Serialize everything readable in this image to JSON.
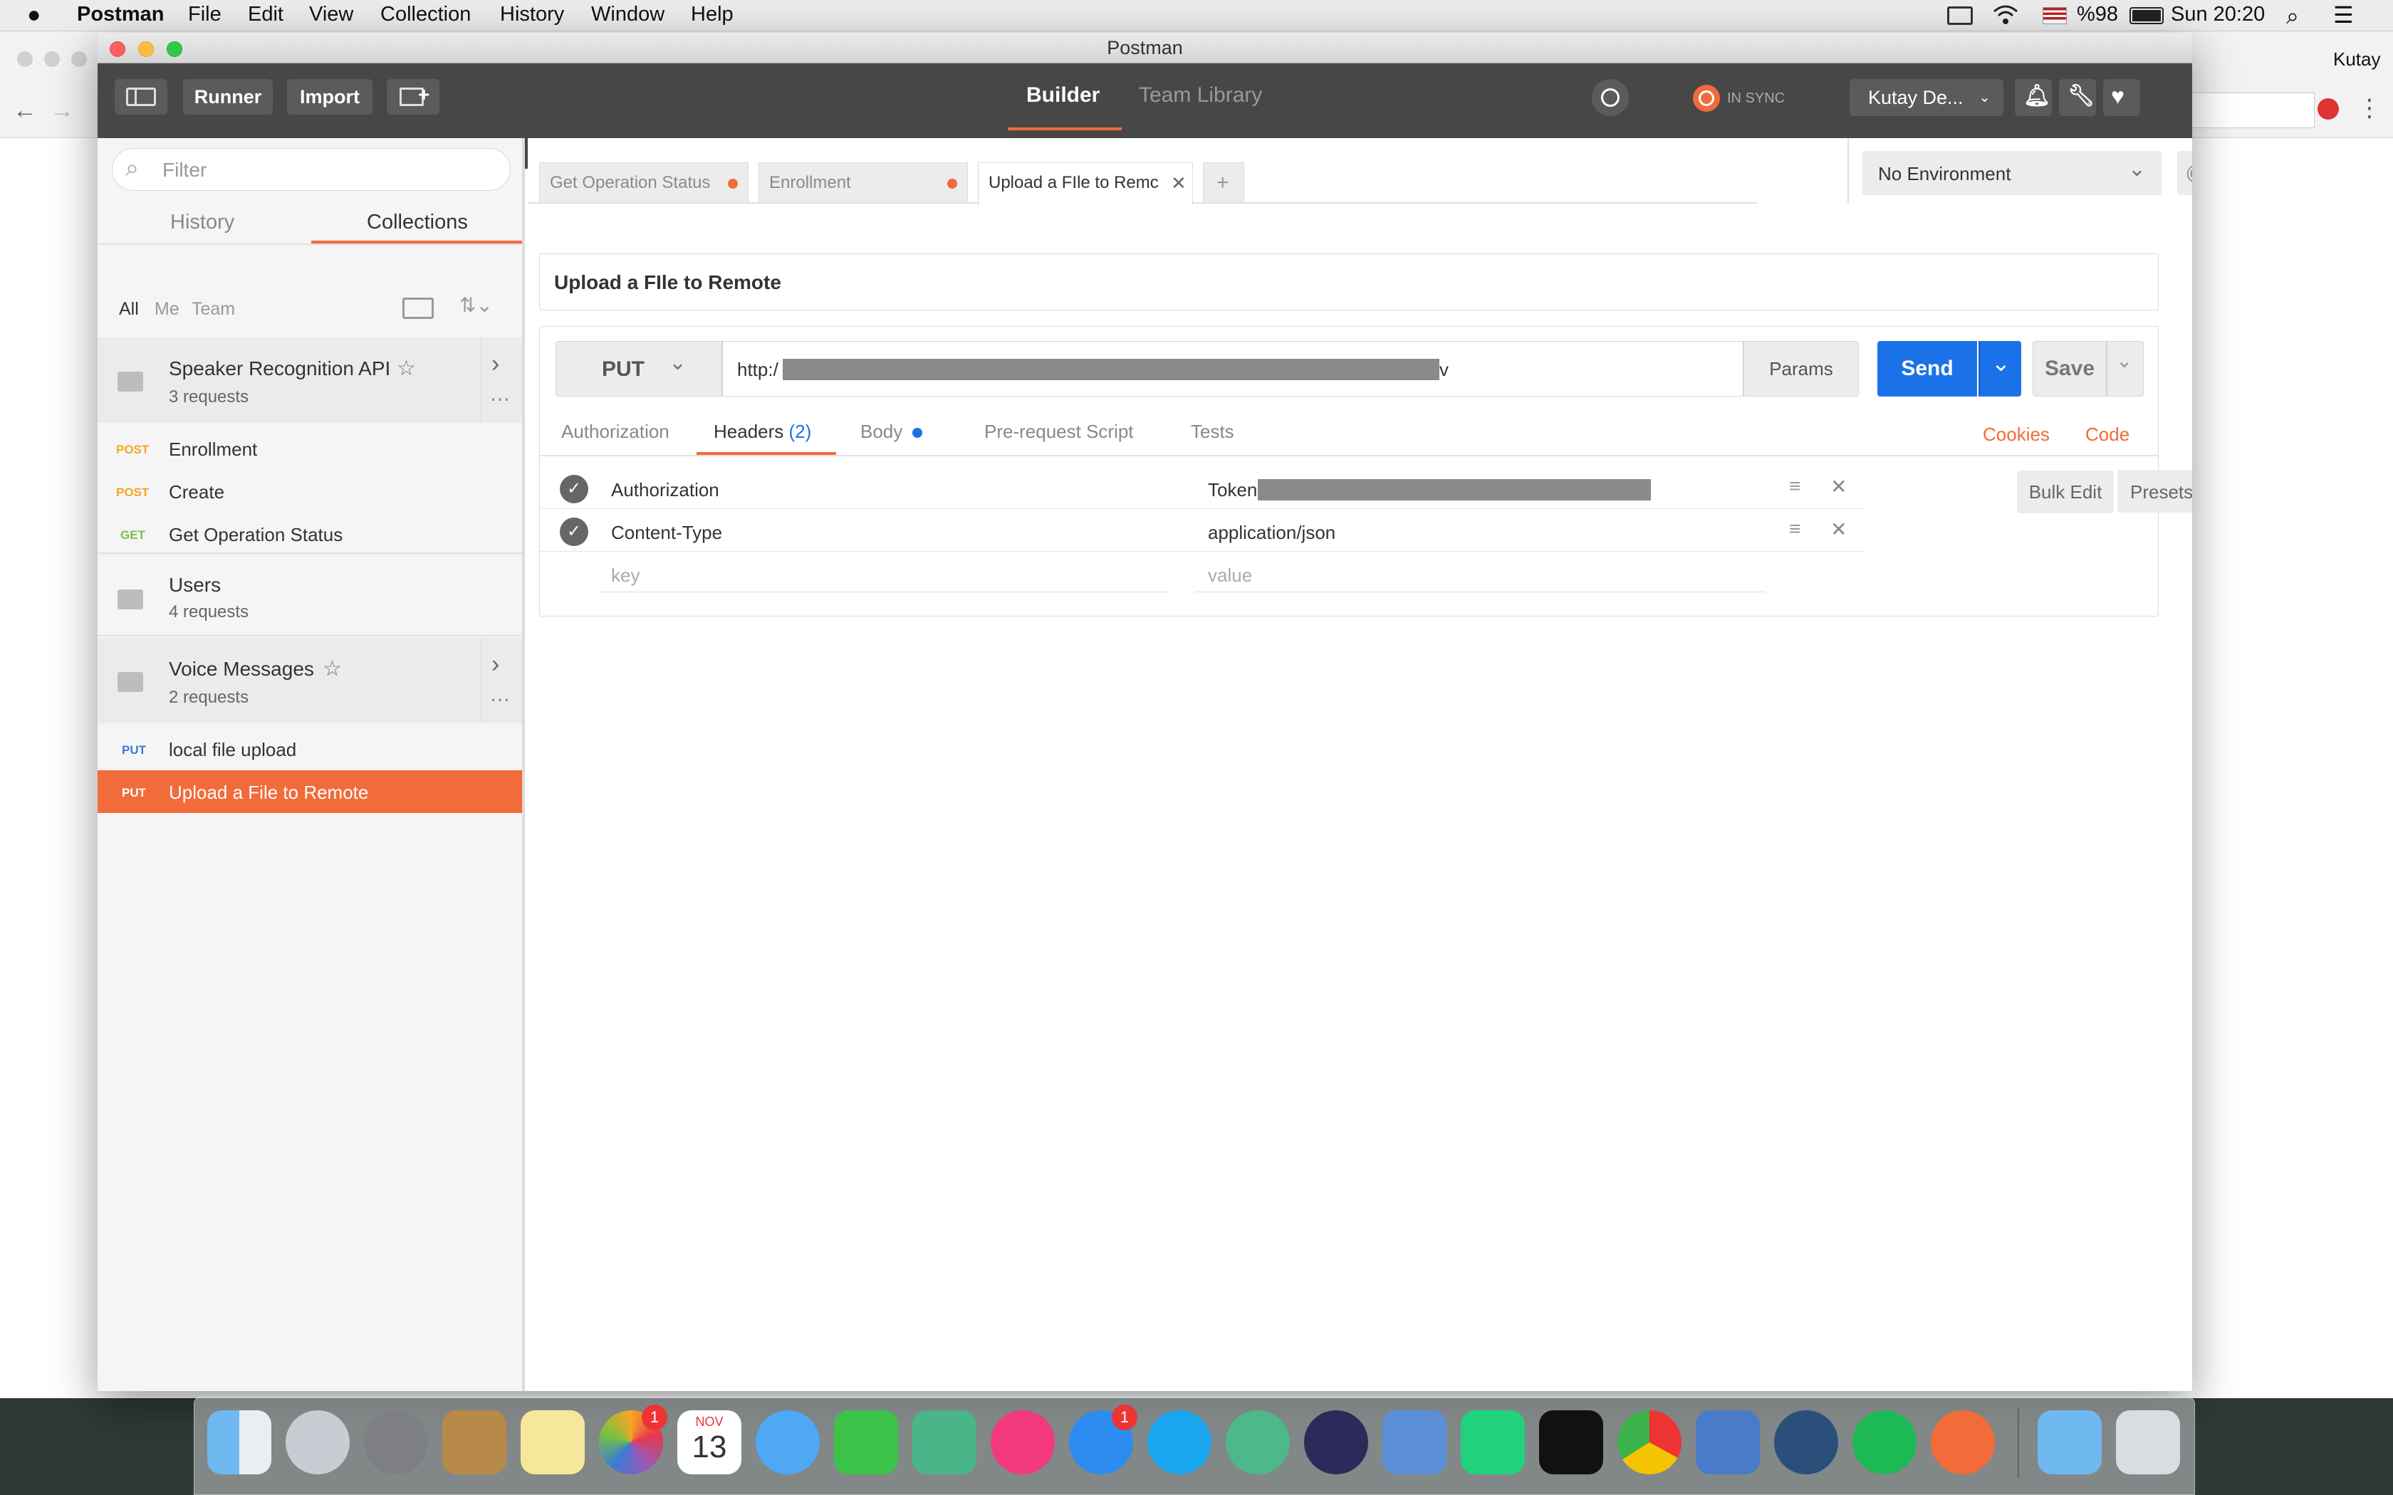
{
  "menubar": {
    "app": "Postman",
    "items": [
      "File",
      "Edit",
      "View",
      "Collection",
      "History",
      "Window",
      "Help"
    ],
    "battery": "%98",
    "clock": "Sun 20:20"
  },
  "bg_browser": {
    "user": "Kutay"
  },
  "window": {
    "title": "Postman"
  },
  "header": {
    "runner": "Runner",
    "import": "Import",
    "tab_builder": "Builder",
    "tab_team_library": "Team Library",
    "sync_status": "IN SYNC",
    "user": "Kutay De..."
  },
  "sidebar": {
    "filter_placeholder": "Filter",
    "tab_history": "History",
    "tab_collections": "Collections",
    "filters": [
      "All",
      "Me",
      "Team"
    ],
    "collections": [
      {
        "name": "Speaker Recognition API",
        "count": "3 requests"
      },
      {
        "name": "Users",
        "count": "4 requests"
      },
      {
        "name": "Voice Messages",
        "count": "2 requests"
      }
    ],
    "requests_speaker": [
      {
        "method": "POST",
        "name": "Enrollment",
        "color": "#f5a623"
      },
      {
        "method": "POST",
        "name": "Create",
        "color": "#f5a623"
      },
      {
        "method": "GET",
        "name": "Get Operation Status",
        "color": "#7ac142"
      }
    ],
    "requests_voice": [
      {
        "method": "PUT",
        "name": "local file upload",
        "color": "#3a7bd5"
      },
      {
        "method": "PUT",
        "name": "Upload a File to Remote",
        "color": "#ffffff"
      }
    ]
  },
  "tabs": [
    {
      "label": "Get Operation Status"
    },
    {
      "label": "Enrollment"
    },
    {
      "label": "Upload a FIle to Remc"
    }
  ],
  "environment": {
    "selected": "No Environment"
  },
  "request": {
    "name": "Upload a FIle to Remote",
    "method": "PUT",
    "url_prefix": "http:/",
    "url_suffix": "v",
    "params": "Params",
    "send": "Send",
    "save": "Save"
  },
  "subtabs": {
    "authorization": "Authorization",
    "headers": "Headers",
    "headers_count": "(2)",
    "body": "Body",
    "prerequest": "Pre-request Script",
    "tests": "Tests",
    "cookies": "Cookies",
    "code": "Code"
  },
  "headers_table": {
    "rows": [
      {
        "key": "Authorization",
        "value": "Token"
      },
      {
        "key": "Content-Type",
        "value": "application/json"
      }
    ],
    "key_placeholder": "key",
    "value_placeholder": "value",
    "bulk_edit": "Bulk Edit",
    "presets": "Presets"
  },
  "dock": {
    "photos_badge": "1",
    "appstore_badge": "1",
    "calendar_month": "NOV",
    "calendar_day": "13"
  },
  "colors": {
    "accent": "#f26b3a",
    "send_blue": "#1b72e8",
    "header_bg": "#474747"
  }
}
